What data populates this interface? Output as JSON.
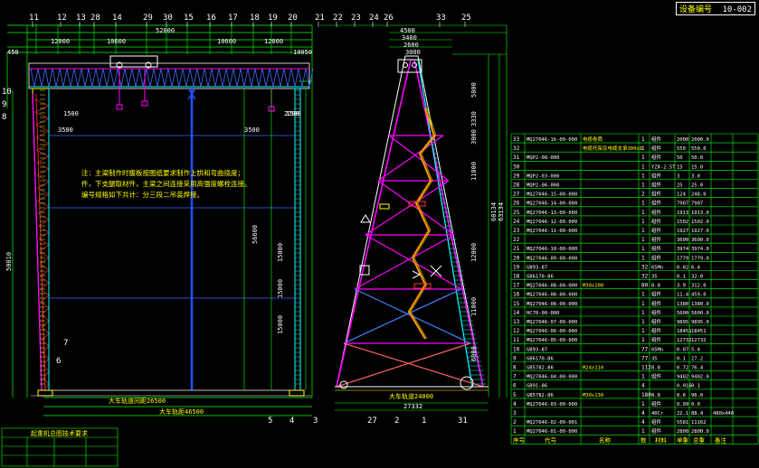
{
  "title_block": {
    "device_no_label": "设备编号",
    "device_no": "10-002"
  },
  "top_dims": [
    "52000",
    "12000",
    "10600",
    "10600",
    "12000",
    "10050",
    "4500",
    "3400",
    "2600",
    "3000",
    "450"
  ],
  "part_callouts_left": [
    "11",
    "12",
    "13",
    "28",
    "14",
    "29",
    "30",
    "15",
    "16",
    "17",
    "18",
    "19",
    "20",
    "21",
    "22",
    "23",
    "24",
    "26",
    "33",
    "25"
  ],
  "part_callouts_right": [
    "7",
    "6",
    "5",
    "4",
    "3",
    "27",
    "2",
    "1",
    "31",
    "10",
    "9",
    "8"
  ],
  "left_dims": [
    "1500",
    "3500",
    "3500",
    "1500",
    "2700"
  ],
  "heights": [
    "50010",
    "56600",
    "15000",
    "15000",
    "15000",
    "3000",
    "60134",
    "63134",
    "5000",
    "3330",
    "3000",
    "11000",
    "12000",
    "11000",
    "6000",
    "1500"
  ],
  "note": {
    "line1": "注：主梁制作时腹板按图纸要求制作上拱和弯曲挠度；",
    "line2": "件，下支腿取材件，主梁之间连接采用高强度螺栓连接。",
    "line3": "编号规格如下共计：分三段二吊装焊接。"
  },
  "bottom_dims": [
    "大车轨道间距26500",
    "大车轨距46500",
    "大车轨道24000",
    "27332"
  ],
  "parts_table": {
    "headers": [
      "序号",
      "代号",
      "名称",
      "数",
      "材料",
      "单重",
      "总重",
      "备注"
    ],
    "rows": [
      [
        "33",
        "MQ27046-16-00-000",
        "电缆卷筒",
        "1",
        "组件",
        "2000",
        "2000.0",
        ""
      ],
      [
        "32",
        "",
        "电缆托架及电缆支承300x8",
        "1",
        "组件",
        "550",
        "550.0",
        ""
      ],
      [
        "31",
        "MQP2-08-000",
        "",
        "1",
        "组件",
        "50",
        "50.0",
        ""
      ],
      [
        "30",
        "",
        "",
        "1",
        "YZR-2.5T",
        "15",
        "15.0",
        ""
      ],
      [
        "29",
        "MQP2-03-000",
        "",
        "1",
        "组件",
        "3",
        "3.0",
        ""
      ],
      [
        "28",
        "MQP2-06-000",
        "",
        "1",
        "组件",
        "25",
        "25.0",
        ""
      ],
      [
        "27",
        "MQ27046-15-00-000",
        "",
        "2",
        "组件",
        "124",
        "248.0",
        ""
      ],
      [
        "26",
        "MQ27046-14-00-000",
        "",
        "1",
        "组件",
        "7907",
        "7907",
        ""
      ],
      [
        "25",
        "MQ27046-13-00-000",
        "",
        "1",
        "组件",
        "1913",
        "1913.0",
        ""
      ],
      [
        "24",
        "MQ27046-12-00-000",
        "",
        "1",
        "组件",
        "1502",
        "1502.0",
        ""
      ],
      [
        "23",
        "MQ27046-11-00-000",
        "",
        "1",
        "组件",
        "1927",
        "1927.0",
        ""
      ],
      [
        "22",
        "",
        "",
        "1",
        "组件",
        "3600",
        "3600.0",
        ""
      ],
      [
        "21",
        "MQ27046-10-00-000",
        "",
        "1",
        "组件",
        "3974",
        "3974.0",
        ""
      ],
      [
        "20",
        "MQ27046-09-00-000",
        "",
        "1",
        "组件",
        "1779",
        "1779.0",
        ""
      ],
      [
        "19",
        "GB93-87",
        "",
        "32",
        "65Mn",
        "0.02",
        "6.4",
        ""
      ],
      [
        "18",
        "GB6170-86",
        "",
        "32",
        "35",
        "0.1",
        "32.0",
        ""
      ],
      [
        "17",
        "MQ27046-08-00-000",
        "M30x100",
        "80",
        "8.8",
        "3.9",
        "312.0",
        ""
      ],
      [
        "16",
        "MQ27046-08-00-000",
        "",
        "1",
        "组件",
        "11.4",
        "459.0",
        ""
      ],
      [
        "15",
        "MQ27046-08-00-000",
        "",
        "1",
        "组件",
        "1380",
        "1380.0",
        ""
      ],
      [
        "14",
        "HC70-00-000",
        "",
        "1",
        "组件",
        "5600",
        "5600.0",
        ""
      ],
      [
        "13",
        "MQ27046-07-00-000",
        "",
        "1",
        "组件",
        "9895",
        "9895.0",
        ""
      ],
      [
        "12",
        "MQ27046-06-00-000",
        "",
        "1",
        "组件",
        "18451",
        "18451",
        ""
      ],
      [
        "11",
        "MQ27046-05-00-000",
        "",
        "1",
        "组件",
        "12732",
        "12732",
        ""
      ],
      [
        "10",
        "GB93-87",
        "",
        "77",
        "65Mn",
        "0.07",
        "5.4",
        ""
      ],
      [
        "9",
        "GB6170-86",
        "",
        "77",
        "35",
        "0.1",
        "27.2",
        ""
      ],
      [
        "8",
        "GB5782-86",
        "M24x110",
        "112",
        "8.8",
        "0.72",
        "76.4",
        ""
      ],
      [
        "7",
        "MQ27046-04-00-000",
        "",
        "1",
        "组件",
        "9402",
        "9402.0",
        ""
      ],
      [
        "6",
        "GB91-86",
        "",
        "4",
        "",
        "0.016",
        "0.1",
        ""
      ],
      [
        "5",
        "GB5782-86",
        "M30x130",
        "180",
        "8.8",
        "0.6",
        "96.0",
        ""
      ],
      [
        "4",
        "MQ27046-03-00-000",
        "",
        "1",
        "组件",
        "0.99",
        "0.0",
        ""
      ],
      [
        "3",
        "",
        "",
        "4",
        "40Cr",
        "22.1",
        "88.4",
        "480x440"
      ],
      [
        "2",
        "MQ27046-02-00-001",
        "",
        "4",
        "组件",
        "5581",
        "11162",
        ""
      ],
      [
        "1",
        "MQ27046-01-00-000",
        "",
        "1",
        "组件",
        "2800",
        "2800.0",
        ""
      ]
    ]
  },
  "stamp": {
    "title": "起重机总图技术要求",
    "lines": [
      "",
      "",
      ""
    ]
  }
}
